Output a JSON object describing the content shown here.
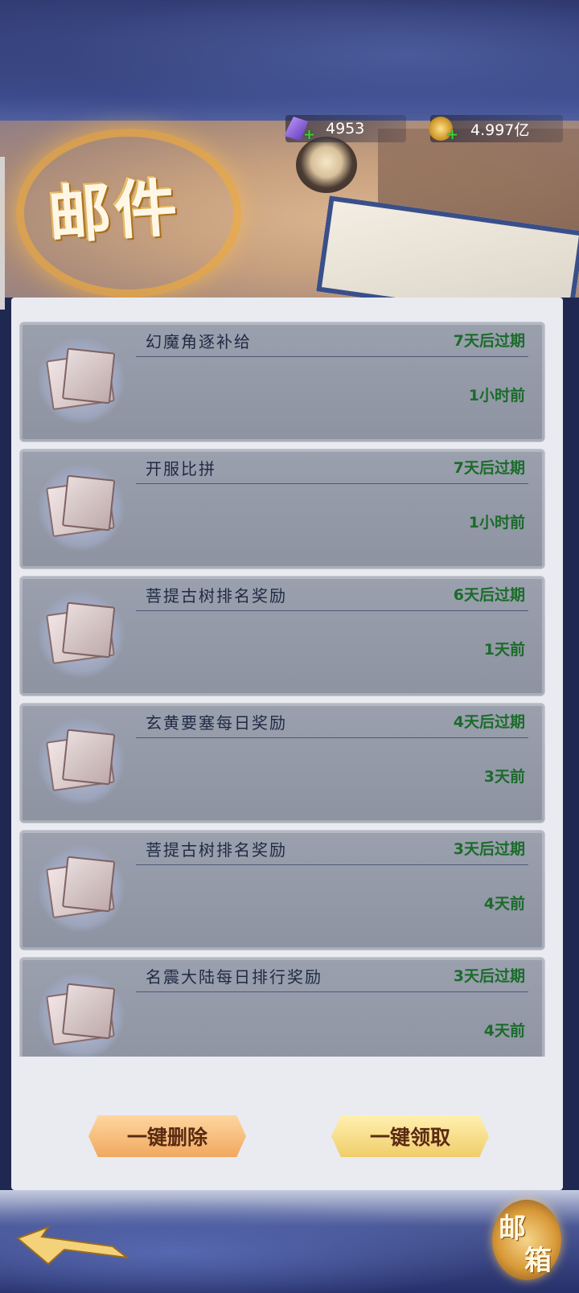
{
  "header": {
    "title": "邮件"
  },
  "currency": {
    "gems": {
      "value": "4953",
      "icon": "purple-crystal-icon"
    },
    "gold": {
      "value": "4.997亿",
      "icon": "gold-coin-icon"
    }
  },
  "mails": [
    {
      "subject": "幻魔角逐补给",
      "expires": "7天后过期",
      "time": "1小时前"
    },
    {
      "subject": "开服比拼",
      "expires": "7天后过期",
      "time": "1小时前"
    },
    {
      "subject": "菩提古树排名奖励",
      "expires": "6天后过期",
      "time": "1天前"
    },
    {
      "subject": "玄黄要塞每日奖励",
      "expires": "4天后过期",
      "time": "3天前"
    },
    {
      "subject": "菩提古树排名奖励",
      "expires": "3天后过期",
      "time": "4天前"
    },
    {
      "subject": "名震大陆每日排行奖励",
      "expires": "3天后过期",
      "time": "4天前"
    }
  ],
  "actions": {
    "delete_all": "一键删除",
    "claim_all": "一键领取"
  },
  "mailbox_badge": {
    "line1": "邮",
    "line2": "箱"
  },
  "colors": {
    "expiry_text": "#1b6b2b",
    "subject_text": "#1f2a44",
    "panel_bg": "#e9ebf1",
    "mail_bg": "#9aa0ad"
  }
}
